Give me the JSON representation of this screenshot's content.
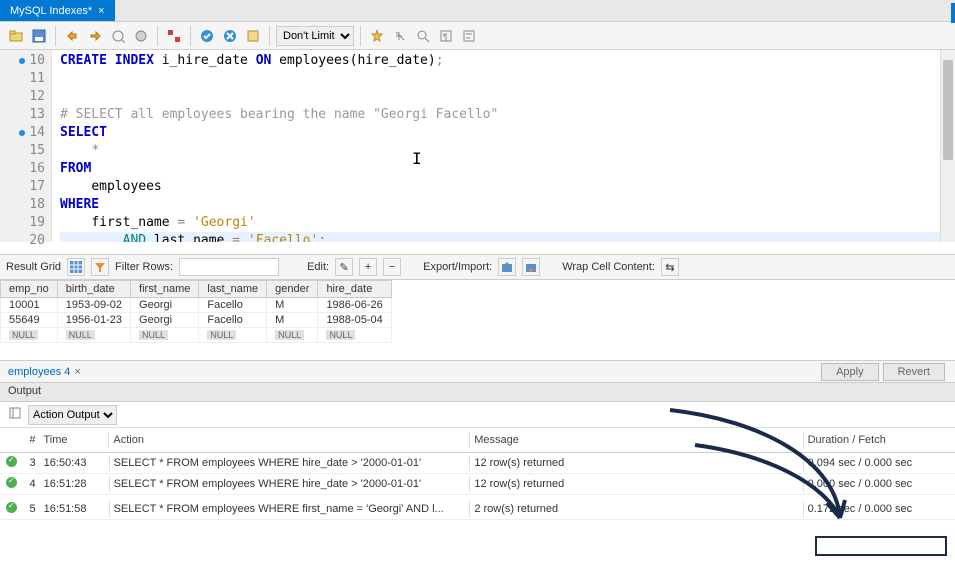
{
  "tab": {
    "title": "MySQL Indexes*",
    "close": "×"
  },
  "toolbar": {
    "limit": "Don't Limit"
  },
  "editor": {
    "lines": [
      {
        "n": 10,
        "dot": true,
        "html": "<span class='kw-blue'>CREATE</span> <span class='kw-blue'>INDEX</span> <span class='kw-black'>i_hire_date</span> <span class='kw-blue'>ON</span> <span class='kw-black'>employees(hire_date)</span><span class='kw-op'>;</span>"
      },
      {
        "n": 11,
        "dot": false,
        "html": ""
      },
      {
        "n": 12,
        "dot": false,
        "html": ""
      },
      {
        "n": 13,
        "dot": false,
        "html": "<span class='kw-comment'># SELECT all employees bearing the name \"Georgi Facello\"</span>"
      },
      {
        "n": 14,
        "dot": true,
        "html": "<span class='kw-blue'>SELECT</span>"
      },
      {
        "n": 15,
        "dot": false,
        "html": "    <span class='kw-op'>*</span>"
      },
      {
        "n": 16,
        "dot": false,
        "html": "<span class='kw-blue'>FROM</span>"
      },
      {
        "n": 17,
        "dot": false,
        "html": "    <span class='kw-black'>employees</span>"
      },
      {
        "n": 18,
        "dot": false,
        "html": "<span class='kw-blue'>WHERE</span>"
      },
      {
        "n": 19,
        "dot": false,
        "html": "    <span class='kw-black'>first_name</span> <span class='kw-op'>=</span> <span class='kw-str'>'Georgi'</span>"
      },
      {
        "n": 20,
        "dot": false,
        "html": "        <span class='kw-teal'>AND</span> <span class='kw-black'>last_name</span> <span class='kw-op'>=</span> <span class='kw-str'>'Facello'</span><span class='kw-op'>;</span>",
        "hl": true
      }
    ]
  },
  "resultsbar": {
    "label": "Result Grid",
    "filter_label": "Filter Rows:",
    "edit_label": "Edit:",
    "export_label": "Export/Import:",
    "wrap_label": "Wrap Cell Content:"
  },
  "columns": [
    "emp_no",
    "birth_date",
    "first_name",
    "last_name",
    "gender",
    "hire_date"
  ],
  "rows": [
    [
      "10001",
      "1953-09-02",
      "Georgi",
      "Facello",
      "M",
      "1986-06-26"
    ],
    [
      "55649",
      "1956-01-23",
      "Georgi",
      "Facello",
      "M",
      "1988-05-04"
    ]
  ],
  "null_cell": "NULL",
  "subtab": {
    "label": "employees 4",
    "close": "×"
  },
  "buttons": {
    "apply": "Apply",
    "revert": "Revert"
  },
  "output": {
    "header": "Output",
    "selector": "Action Output",
    "headers": {
      "num": "#",
      "time": "Time",
      "action": "Action",
      "msg": "Message",
      "dur": "Duration / Fetch"
    },
    "rows": [
      {
        "num": "3",
        "time": "16:50:43",
        "action": "SELECT     * FROM    employees  WHERE     hire_date > '2000-01-01'",
        "msg": "12 row(s) returned",
        "dur": "0.094 sec / 0.000 sec"
      },
      {
        "num": "4",
        "time": "16:51:28",
        "action": "SELECT     * FROM    employees  WHERE     hire_date > '2000-01-01'",
        "msg": "12 row(s) returned",
        "dur": "0.000 sec / 0.000 sec"
      },
      {
        "num": "5",
        "time": "16:51:58",
        "action": "SELECT     * FROM    employees WHERE     first_name = 'Georgi'         AND l...",
        "msg": "2 row(s) returned",
        "dur": "0.172 sec / 0.000 sec"
      }
    ]
  }
}
